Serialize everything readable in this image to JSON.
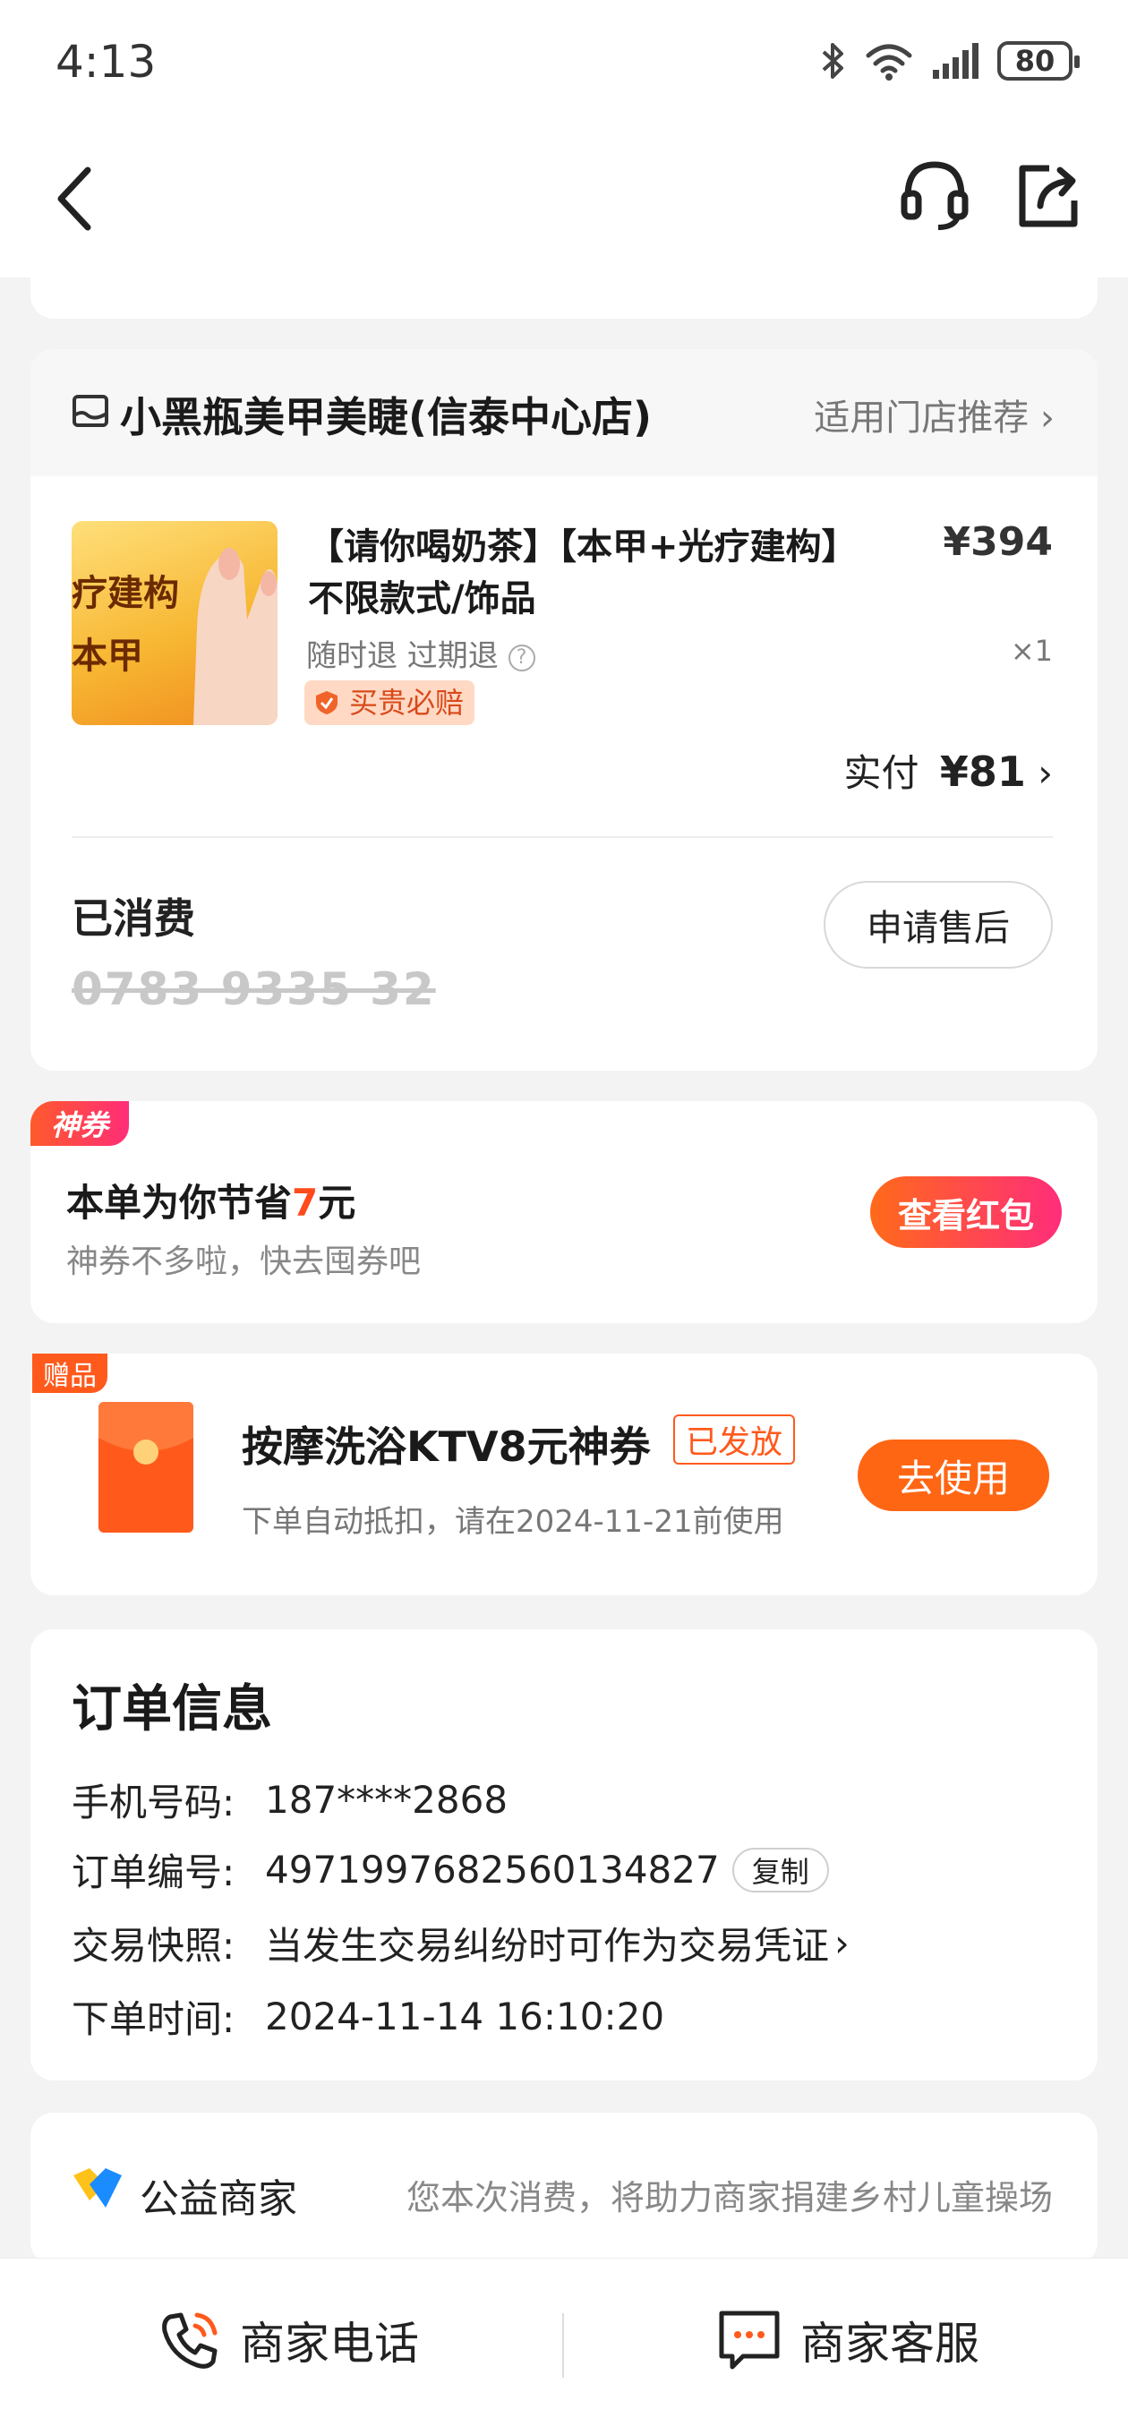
{
  "status_bar": {
    "time": "4:13",
    "battery": "80"
  },
  "shop": {
    "name": "小黑瓶美甲美睫(信泰中心店)",
    "link": "适用门店推荐"
  },
  "product": {
    "title_line1": "【请你喝奶茶】【本甲+光疗建构】",
    "title_line2": "不限款式/饰品",
    "price": "¥394",
    "refund_policy": "随时退 过期退",
    "quantity": "×1",
    "badge": "买贵必赔",
    "paid_label": "实付",
    "paid_amount": "¥81",
    "thumb_text_1": "疗建构",
    "thumb_text_2": "本甲"
  },
  "voucher": {
    "status": "已消费",
    "code": "0783 9335 32",
    "after_sale_button": "申请售后"
  },
  "saving": {
    "tag": "神券",
    "text_prefix": "本单为你节省",
    "amount": "7",
    "text_suffix": "元",
    "subtext": "神券不多啦，快去囤券吧",
    "button": "查看红包"
  },
  "gift": {
    "tag": "赠品",
    "title": "按摩洗浴KTV8元神券",
    "status": "已发放",
    "subtext": "下单自动抵扣，请在2024-11-21前使用",
    "button": "去使用"
  },
  "order_info": {
    "title": "订单信息",
    "phone_label": "手机号码:",
    "phone": "187****2868",
    "order_no_label": "订单编号:",
    "order_no": "4971997682560134827",
    "copy_button": "复制",
    "snapshot_label": "交易快照:",
    "snapshot_text": "当发生交易纠纷时可作为交易凭证",
    "time_label": "下单时间:",
    "time": "2024-11-14 16:10:20"
  },
  "charity": {
    "name": "公益商家",
    "description": "您本次消费，将助力商家捐建乡村儿童操场"
  },
  "bottom_bar": {
    "phone_label": "商家电话",
    "service_label": "商家客服"
  },
  "colors": {
    "accent": "#ff5a1c",
    "gradient_pink": "#ff2d7a",
    "background": "#f3f3f3"
  }
}
